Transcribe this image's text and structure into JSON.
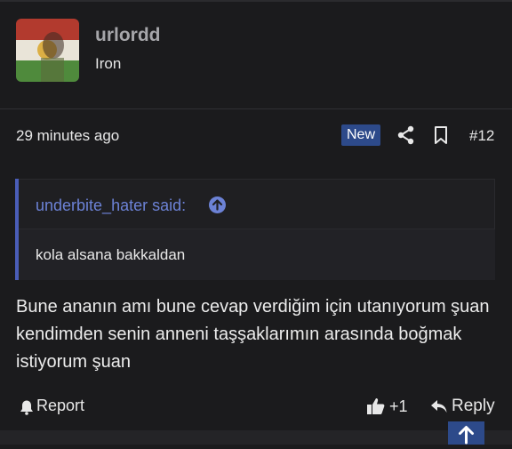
{
  "post": {
    "username": "urlordd",
    "user_title": "Iron",
    "timestamp": "29 minutes ago",
    "badge": "New",
    "post_number": "#12",
    "quote": {
      "author": "underbite_hater said:",
      "text": "kola alsana bakkaldan"
    },
    "message": "Bune ananın amı bune cevap verdiğim için utanıyorum şuan kendimden senin anneni taşşaklarımın arasında boğmak istiyorum şuan",
    "actions": {
      "report_label": "Report",
      "like_label": "+1",
      "reply_label": "Reply"
    }
  },
  "colors": {
    "background": "#1b1b1d",
    "accent": "#2d4a8a",
    "quote_link": "#6c82d6"
  },
  "icons": [
    "share-icon",
    "bookmark-icon",
    "arrow-up-circle-icon",
    "bell-icon",
    "thumbs-up-icon",
    "reply-arrow-icon",
    "arrow-up-icon"
  ]
}
